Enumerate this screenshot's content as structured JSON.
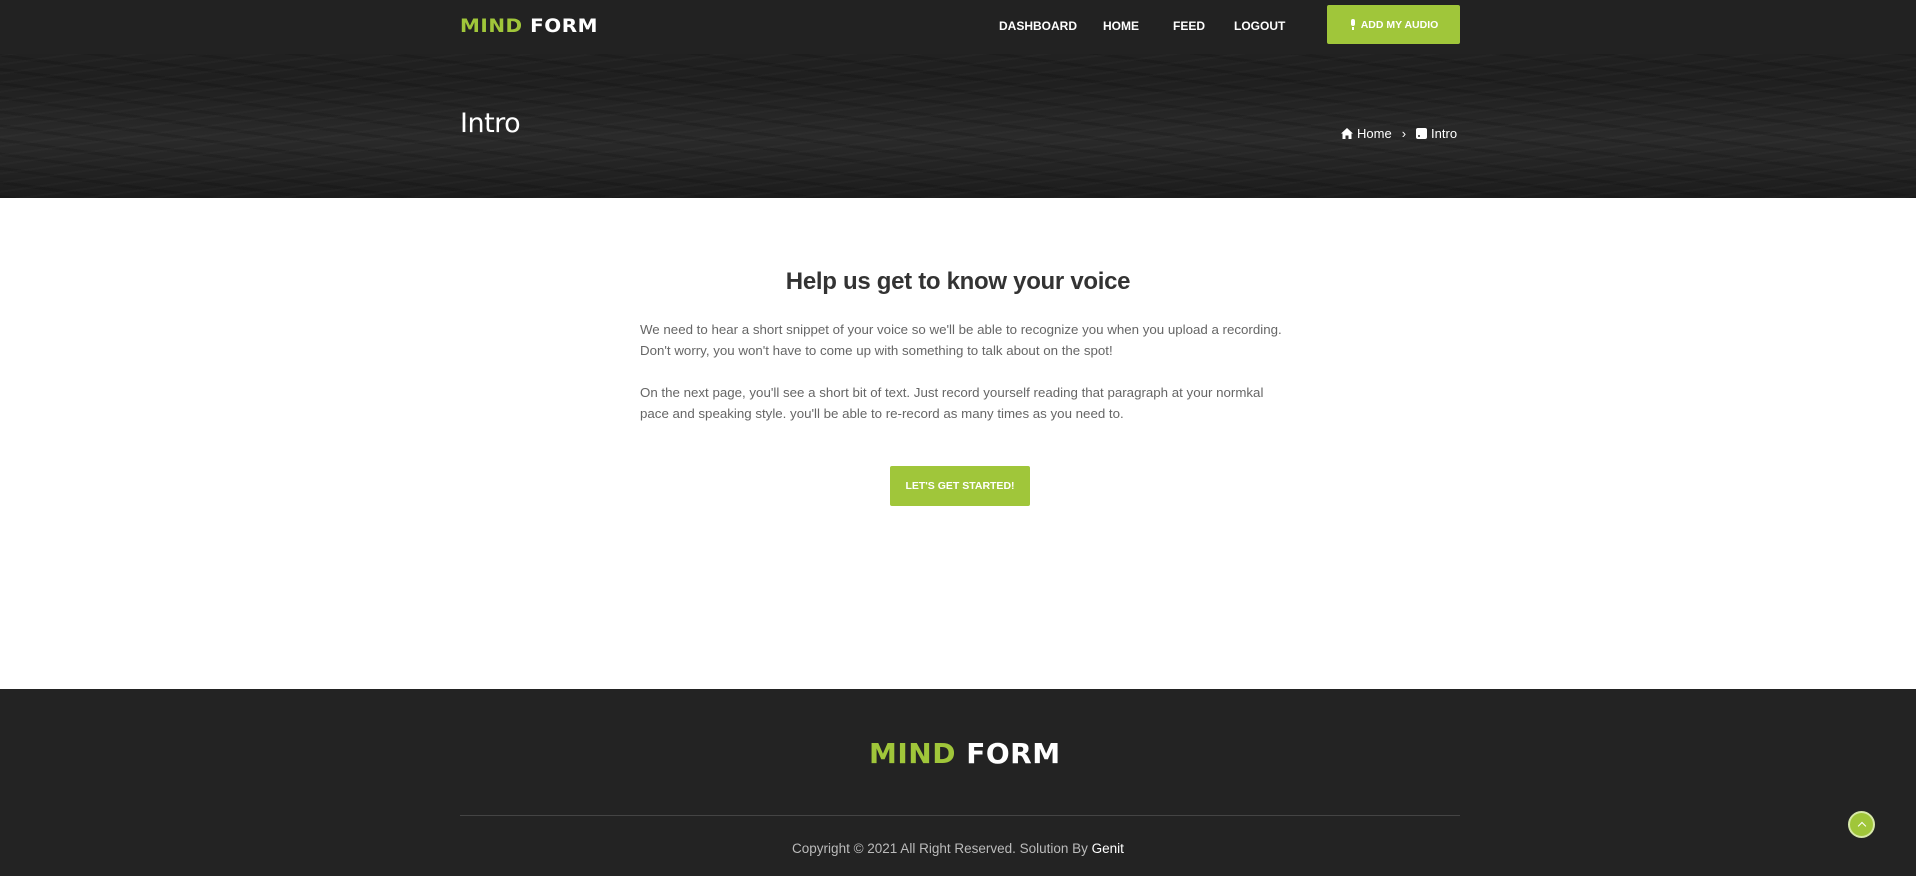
{
  "header": {
    "logo": {
      "part1": "MIND",
      "part2": "FORM"
    },
    "nav": [
      "DASHBOARD",
      "HOME",
      "FEED",
      "LOGOUT"
    ],
    "add_audio_label": "ADD MY AUDIO",
    "page_title": "Intro",
    "breadcrumb": {
      "home": "Home",
      "current": "Intro"
    }
  },
  "main": {
    "title": "Help us get to know your voice",
    "paragraph1": "We need to hear a short snippet of your voice so we'll be able to recognize you when you upload a recording. Don't worry, you won't have to come up with something to talk about on the spot!",
    "paragraph2": "On the next page, you'll see a short bit of text. Just record yourself reading that paragraph at your normkal pace and speaking style. you'll be able to re-record as many times as you need to.",
    "start_button": "LET'S GET STARTED!"
  },
  "footer": {
    "logo": {
      "part1": "MIND",
      "part2": "FORM"
    },
    "copyright_text": "Copyright © 2021 All Right Reserved. Solution By ",
    "copyright_link": "Genit"
  },
  "colors": {
    "accent": "#a0c63a",
    "dark": "#222222"
  }
}
